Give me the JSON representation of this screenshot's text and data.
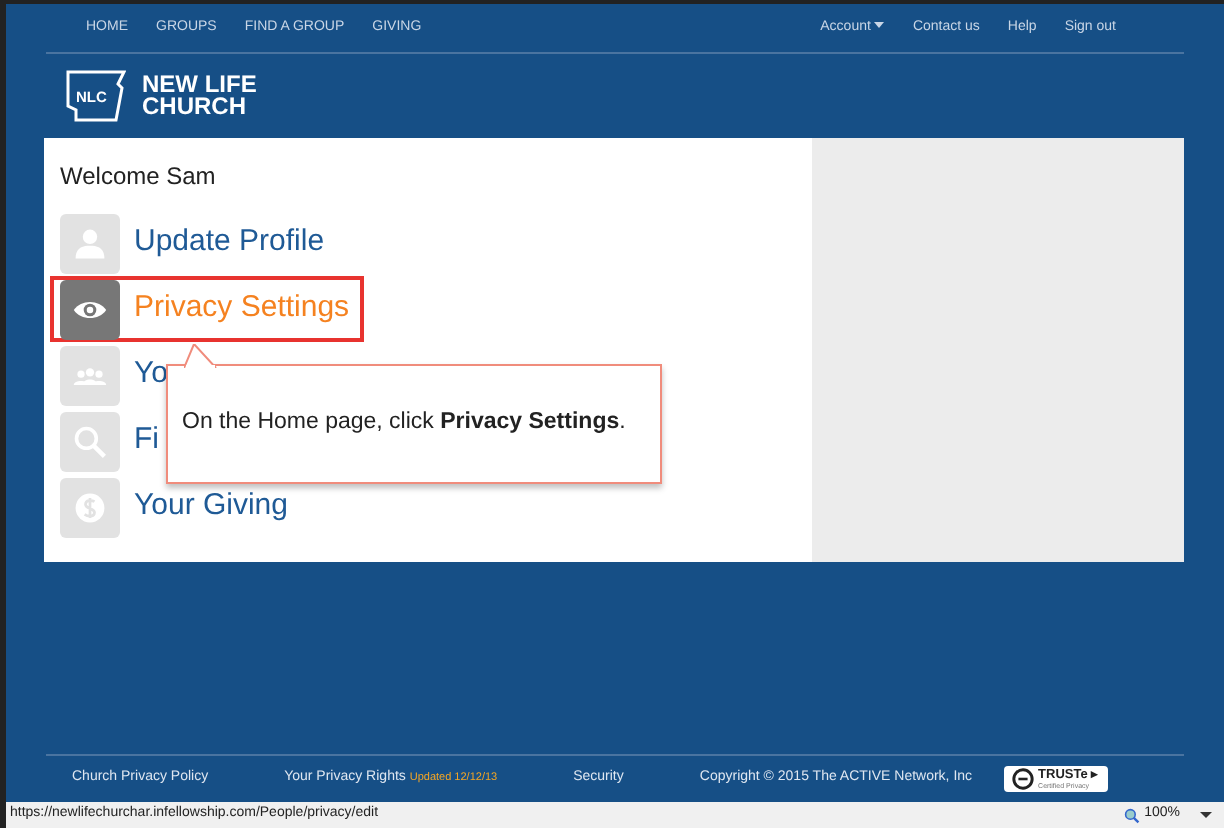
{
  "top_nav": {
    "left": [
      "HOME",
      "GROUPS",
      "FIND A GROUP",
      "GIVING"
    ],
    "right": [
      {
        "label": "Account",
        "dropdown": true
      },
      {
        "label": "Contact us",
        "dropdown": false
      },
      {
        "label": "Help",
        "dropdown": false
      },
      {
        "label": "Sign out",
        "dropdown": false
      }
    ]
  },
  "logo": {
    "mark": "NLC",
    "lines": [
      "NEW LIFE",
      "CHURCH"
    ]
  },
  "welcome": "Welcome Sam",
  "menu": [
    {
      "label": "Update Profile",
      "kind": "person",
      "selected": false
    },
    {
      "label": "Privacy Settings",
      "kind": "eye",
      "selected": true
    },
    {
      "label": "Yo",
      "kind": "group",
      "selected": false
    },
    {
      "label": "Fi",
      "kind": "search",
      "selected": false
    },
    {
      "label": "Your Giving",
      "kind": "dollar",
      "selected": false
    }
  ],
  "callout": {
    "text": "On the Home page, click **Privacy Settings**."
  },
  "footer": {
    "links": [
      {
        "label": "Church Privacy Policy"
      },
      {
        "label": "Your Privacy Rights",
        "note": "Updated 12/12/13"
      },
      {
        "label": "Security"
      }
    ],
    "copyright": "Copyright © 2015 The ACTIVE Network, Inc",
    "seal": {
      "name": "TRUSTe",
      "arrow": "▸",
      "caption": "Certified Privacy"
    }
  },
  "status_bar": {
    "url": "https://newlifechurchar.infellowship.com/People/privacy/edit",
    "zoom": "100%"
  }
}
